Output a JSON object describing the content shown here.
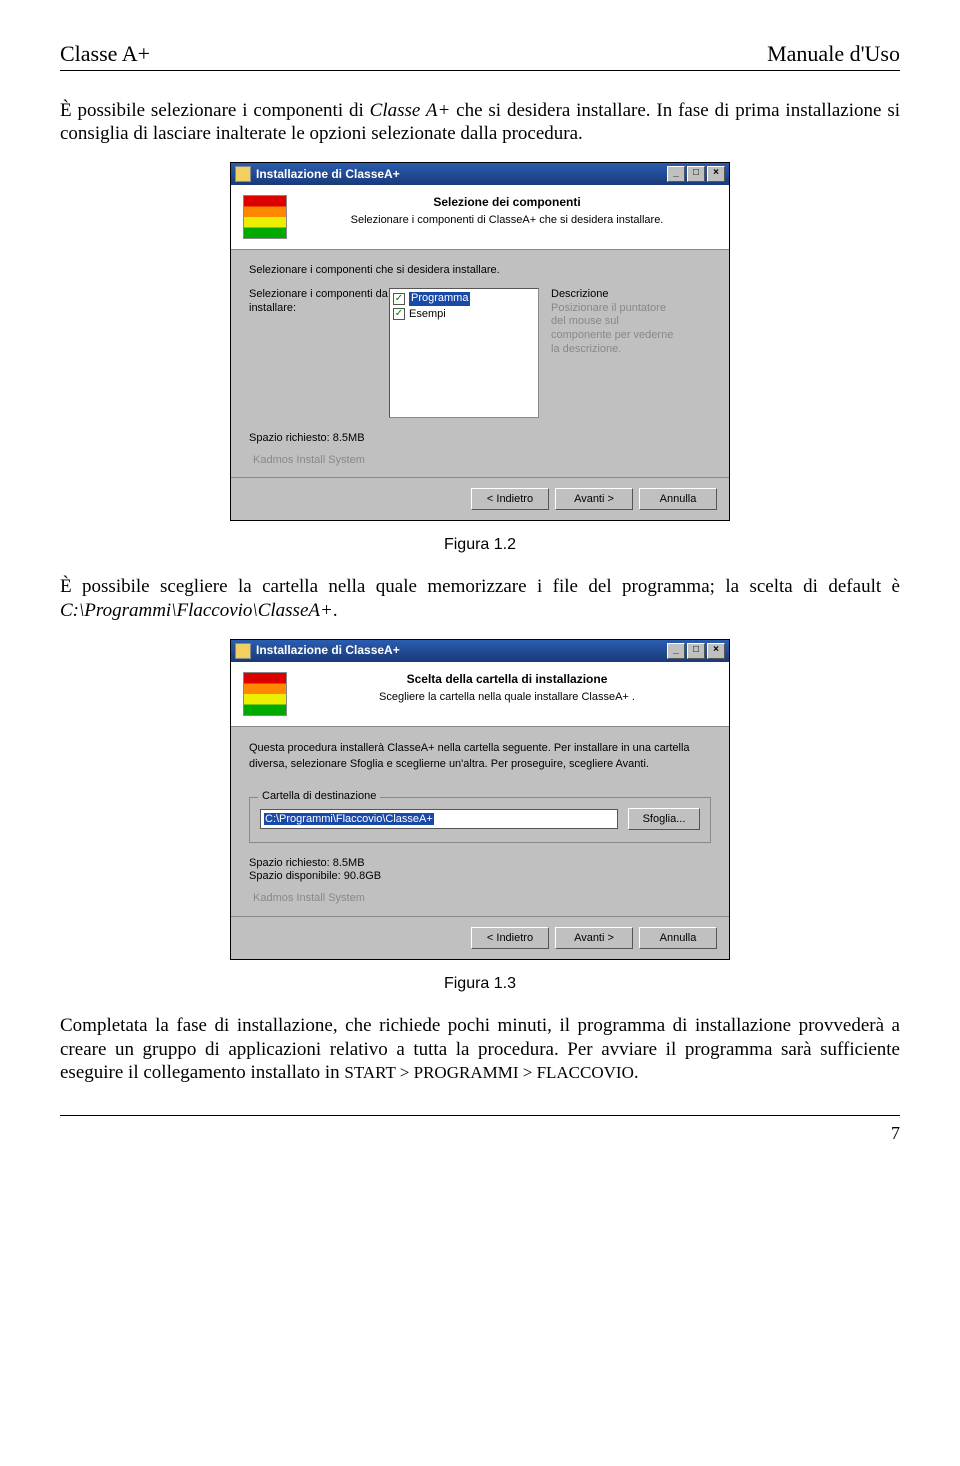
{
  "header": {
    "left": "Classe A+",
    "right": "Manuale d'Uso"
  },
  "para1_a": "È possibile selezionare i componenti di ",
  "para1_it": "Classe A+",
  "para1_b": " che si desidera installare. In fase di prima installazione si consiglia di lasciare inalterate le opzioni selezionate dalla procedura.",
  "caption1": "Figura 1.2",
  "para2_a": "È possibile scegliere la cartella nella quale memorizzare i file del programma; la scelta di default è ",
  "para2_it": "C:\\Programmi\\Flaccovio\\ClasseA+",
  "para2_b": ".",
  "caption2": "Figura 1.3",
  "para3": "Completata la fase di installazione, che richiede pochi minuti, il programma di installazione provvederà a creare un gruppo di applicazioni relativo a tutta la procedura. Per avviare il programma sarà sufficiente eseguire il collegamento installato in ",
  "para3_sc": "START > PROGRAMMI > FLACCOVIO",
  "para3_end": ".",
  "page_no": "7",
  "win1": {
    "title": "Installazione di ClasseA+",
    "banner_title": "Selezione dei componenti",
    "banner_sub": "Selezionare i componenti di ClasseA+  che si desidera installare.",
    "instr": "Selezionare i componenti che si desidera installare.",
    "sel_label": "Selezionare i componenti da installare:",
    "items": [
      "Programma",
      "Esempi"
    ],
    "desc_title": "Descrizione",
    "desc_body": "Posizionare il puntatore del mouse sul componente per vederne la descrizione.",
    "space": "Spazio richiesto: 8.5MB",
    "sys": "Kadmos Install System",
    "back": "< Indietro",
    "next": "Avanti >",
    "cancel": "Annulla"
  },
  "win2": {
    "title": "Installazione di ClasseA+",
    "banner_title": "Scelta della cartella di installazione",
    "banner_sub": "Scegliere la cartella nella quale installare ClasseA+ .",
    "body": "Questa procedura installerà ClasseA+  nella cartella seguente. Per installare in una cartella diversa, selezionare Sfoglia e sceglierne un'altra. Per proseguire, scegliere Avanti.",
    "legend": "Cartella di destinazione",
    "path": "C:\\Programmi\\Flaccovio\\ClasseA+",
    "browse": "Sfoglia...",
    "space_req": "Spazio richiesto: 8.5MB",
    "space_avail": "Spazio disponibile: 90.8GB",
    "sys": "Kadmos Install System",
    "back": "< Indietro",
    "next": "Avanti >",
    "cancel": "Annulla"
  }
}
